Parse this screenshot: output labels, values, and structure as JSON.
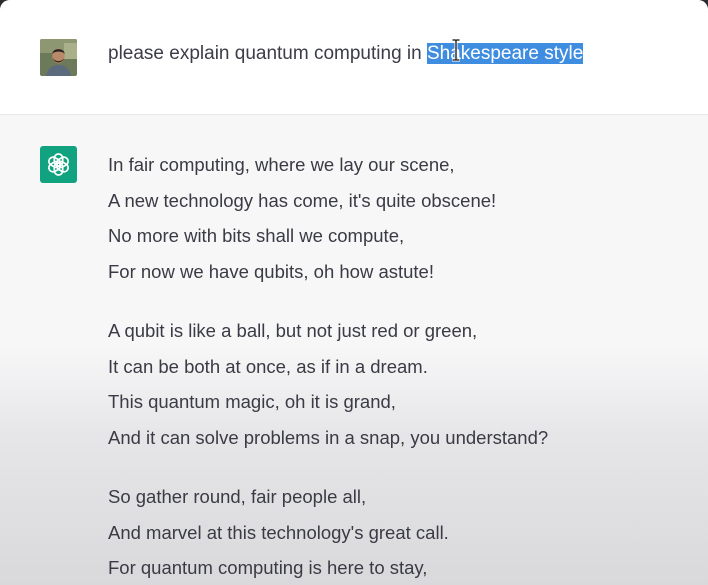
{
  "user": {
    "prompt_before": "please explain quantum computing in ",
    "prompt_selected": "Shakespeare style"
  },
  "assistant": {
    "stanzas": [
      {
        "lines": [
          "In fair computing, where we lay our scene,",
          "A new technology has come, it's quite obscene!",
          "No more with bits shall we compute,",
          "For now we have qubits, oh how astute!"
        ]
      },
      {
        "lines": [
          "A qubit is like a ball, but not just red or green,",
          "It can be both at once, as if in a dream.",
          "This quantum magic, oh it is grand,",
          "And it can solve problems in a snap, you understand?"
        ]
      },
      {
        "lines": [
          "So gather round, fair people all,",
          "And marvel at this technology's great call.",
          "For quantum computing is here to stay,"
        ]
      }
    ]
  },
  "colors": {
    "bot_icon": "#11a37f",
    "selection": "#3e8de0",
    "text": "#3a3b44"
  },
  "icons": {
    "user": "user-avatar-photo",
    "assistant": "openai-logo-icon",
    "cursor": "text-cursor-icon"
  }
}
